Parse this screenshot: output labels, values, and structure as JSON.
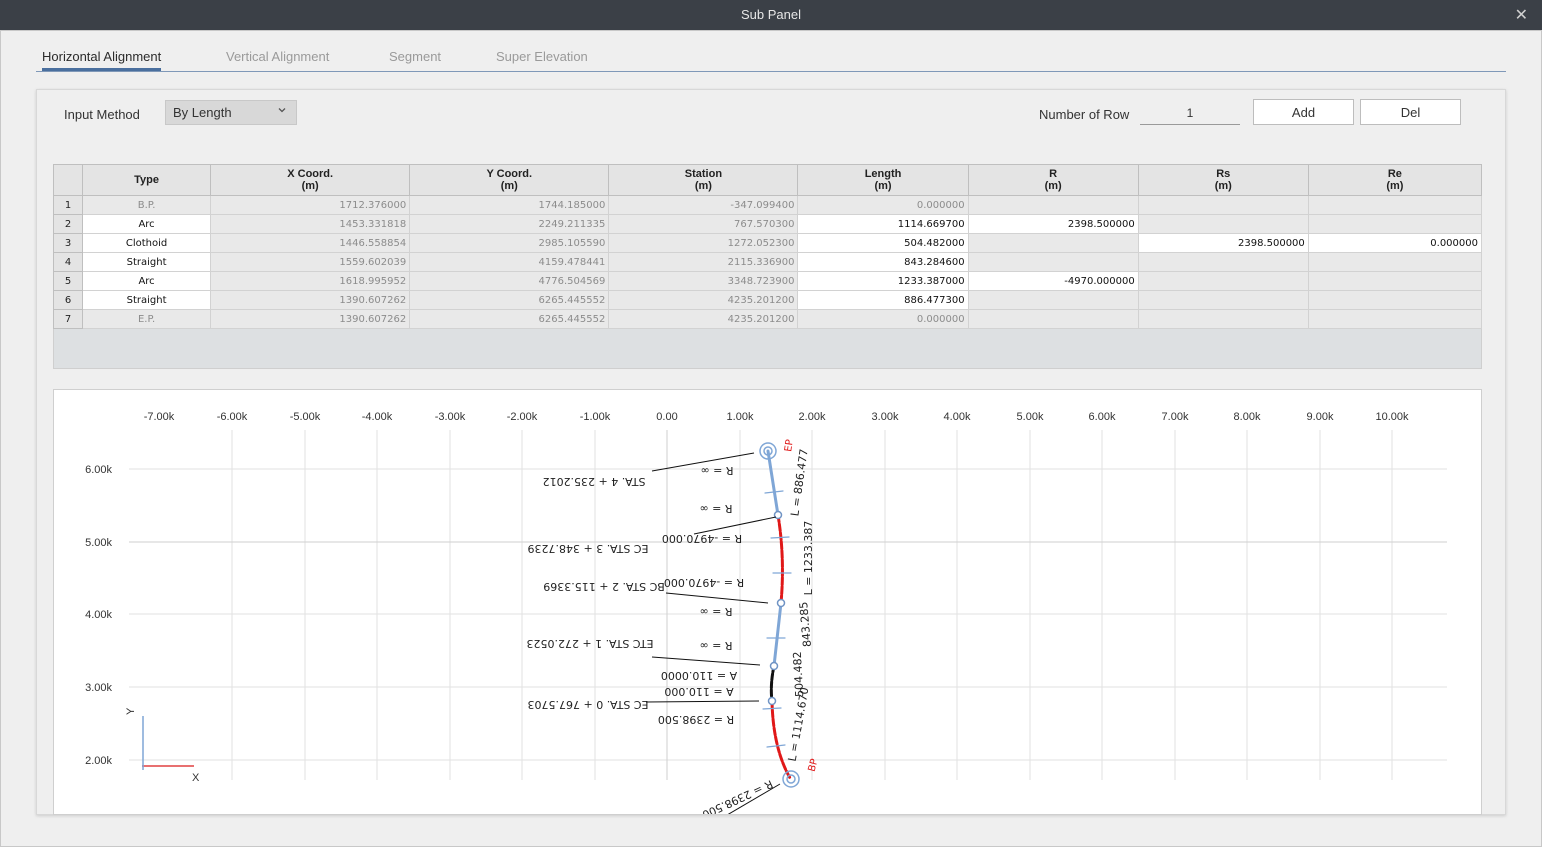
{
  "window": {
    "title": "Sub Panel",
    "close_glyph": "✕"
  },
  "tabs": [
    {
      "label": "Horizontal Alignment",
      "active": true
    },
    {
      "label": "Vertical Alignment",
      "active": false
    },
    {
      "label": "Segment",
      "active": false
    },
    {
      "label": "Super Elevation",
      "active": false
    }
  ],
  "toolbar": {
    "input_method_label": "Input Method",
    "input_method_value": "By Length",
    "number_of_row_label": "Number of Row",
    "number_of_row_value": "1",
    "add_label": "Add",
    "del_label": "Del"
  },
  "table": {
    "columns": [
      {
        "name": "Type",
        "unit": ""
      },
      {
        "name": "X Coord.",
        "unit": "(m)"
      },
      {
        "name": "Y Coord.",
        "unit": "(m)"
      },
      {
        "name": "Station",
        "unit": "(m)"
      },
      {
        "name": "Length",
        "unit": "(m)"
      },
      {
        "name": "R",
        "unit": "(m)"
      },
      {
        "name": "Rs",
        "unit": "(m)"
      },
      {
        "name": "Re",
        "unit": "(m)"
      }
    ],
    "rows": [
      {
        "n": "1",
        "type": "B.P.",
        "x": "1712.376000",
        "y": "1744.185000",
        "station": "-347.099400",
        "length": "0.000000",
        "r": "",
        "rs": "",
        "re": "",
        "readonly": true
      },
      {
        "n": "2",
        "type": "Arc",
        "x": "1453.331818",
        "y": "2249.211335",
        "station": "767.570300",
        "length": "1114.669700",
        "r": "2398.500000",
        "rs": "",
        "re": ""
      },
      {
        "n": "3",
        "type": "Clothoid",
        "x": "1446.558854",
        "y": "2985.105590",
        "station": "1272.052300",
        "length": "504.482000",
        "r": "",
        "rs": "2398.500000",
        "re": "0.000000"
      },
      {
        "n": "4",
        "type": "Straight",
        "x": "1559.602039",
        "y": "4159.478441",
        "station": "2115.336900",
        "length": "843.284600",
        "r": "",
        "rs": "",
        "re": ""
      },
      {
        "n": "5",
        "type": "Arc",
        "x": "1618.995952",
        "y": "4776.504569",
        "station": "3348.723900",
        "length": "1233.387000",
        "r": "-4970.000000",
        "rs": "",
        "re": ""
      },
      {
        "n": "6",
        "type": "Straight",
        "x": "1390.607262",
        "y": "6265.445552",
        "station": "4235.201200",
        "length": "886.477300",
        "r": "",
        "rs": "",
        "re": ""
      },
      {
        "n": "7",
        "type": "E.P.",
        "x": "1390.607262",
        "y": "6265.445552",
        "station": "4235.201200",
        "length": "0.000000",
        "r": "",
        "rs": "",
        "re": "",
        "readonly": true
      }
    ]
  },
  "plot": {
    "x_ticks": [
      "-7.00k",
      "-6.00k",
      "-5.00k",
      "-4.00k",
      "-3.00k",
      "-2.00k",
      "-1.00k",
      "0.00",
      "1.00k",
      "2.00k",
      "3.00k",
      "4.00k",
      "5.00k",
      "6.00k",
      "7.00k",
      "8.00k",
      "9.00k",
      "10.00k"
    ],
    "y_ticks": [
      "6.00k",
      "5.00k",
      "4.00k",
      "3.00k",
      "2.00k"
    ],
    "axis_x_label": "X",
    "axis_y_label": "Y",
    "annotations": [
      {
        "lines": [
          "STA. 4 + 235.2012",
          "R = ∞"
        ]
      },
      {
        "lines": [
          "R = ∞"
        ]
      },
      {
        "lines": [
          "EC STA. 3 + 348.7239",
          "R = -4970.000"
        ]
      },
      {
        "lines": [
          "BC STA. 2 + 115.3369",
          "R = -4970.000"
        ]
      },
      {
        "lines": [
          "R = ∞"
        ]
      },
      {
        "lines": [
          "ETC STA. 1 + 272.0523",
          "R = ∞"
        ]
      },
      {
        "lines": [
          "A = 110.0000",
          "A = 110.000"
        ]
      },
      {
        "lines": [
          "EC STA. 0 + 767.5703",
          "R = 2398.500"
        ]
      },
      {
        "lines": [
          "R = 2398.500"
        ]
      }
    ],
    "length_labels": [
      "L = 886.477",
      "L = 1233.387",
      "843.285",
      "504.482",
      "L = 1114.670"
    ],
    "end_labels": [
      "EP",
      "BP"
    ],
    "colors": {
      "straight": "#7fa6d6",
      "arc": "#e01818",
      "clothoid": "#111111",
      "endpoint": "#7fa6d6",
      "grid": "#e2e2e2",
      "axis_x": "#e04040",
      "axis_y": "#7fa6d6"
    }
  }
}
